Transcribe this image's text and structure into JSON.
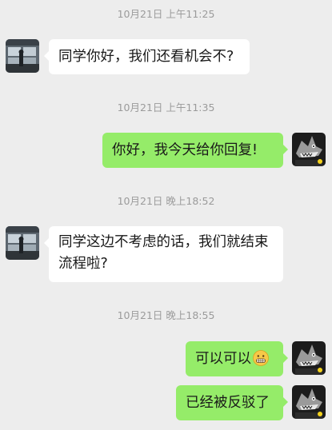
{
  "chat": {
    "messages": [
      {
        "timestamp": "10月21日 上午11:25",
        "sender": "other",
        "lines": [
          "同学你好，我们还看机会不?"
        ]
      },
      {
        "timestamp": "10月21日 上午11:35",
        "sender": "self",
        "lines": [
          "你好，我今天给你回复!"
        ]
      },
      {
        "timestamp": "10月21日 晚上18:52",
        "sender": "other",
        "lines": [
          "同学这边不考虑的话，我们就结束",
          "流程啦?"
        ]
      },
      {
        "timestamp": "10月21日 晚上18:55",
        "sender": "self",
        "lines": [
          "可以可以"
        ],
        "emoji": "grimacing-face-emoji"
      },
      {
        "sender": "self",
        "lines": [
          "已经被反驳了"
        ]
      }
    ]
  },
  "colors": {
    "background": "#ededed",
    "self_bubble": "#95ec69",
    "other_bubble": "#ffffff",
    "timestamp_text": "#9b9b9b"
  }
}
